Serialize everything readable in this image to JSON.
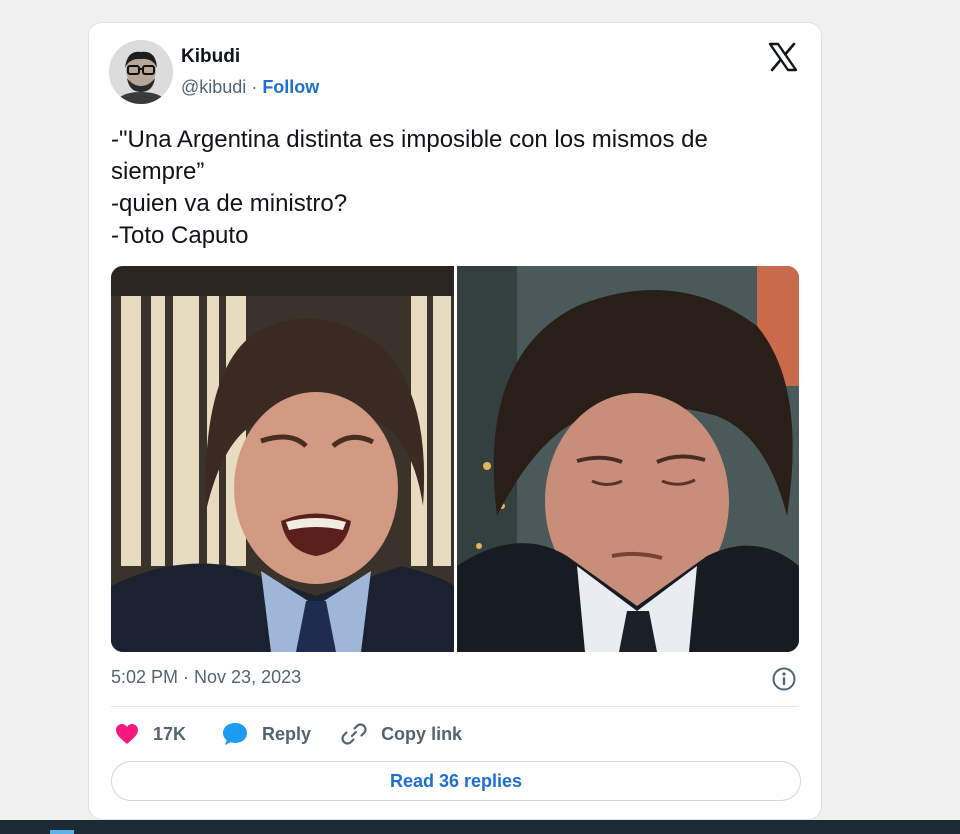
{
  "tweet": {
    "author_name": "Kibudi",
    "handle": "@kibudi",
    "separator": " · ",
    "follow_label": "Follow",
    "text_lines": [
      "-\"Una Argentina distinta es imposible con los mismos de",
      "siempre”",
      "-quien va de ministro?",
      "-Toto Caputo"
    ],
    "timestamp": "5:02 PM · Nov 23, 2023",
    "likes_count": "17K",
    "reply_label": "Reply",
    "copy_link_label": "Copy link",
    "read_replies_label": "Read 36 replies"
  },
  "icons": {
    "like": "heart-icon",
    "reply": "speech-bubble-icon",
    "copy": "link-icon",
    "info": "info-icon",
    "brand": "x-logo-icon"
  },
  "colors": {
    "like": "#f91880",
    "reply": "#1d9bf0",
    "link_text": "#1d6fd1",
    "muted": "#536471"
  }
}
